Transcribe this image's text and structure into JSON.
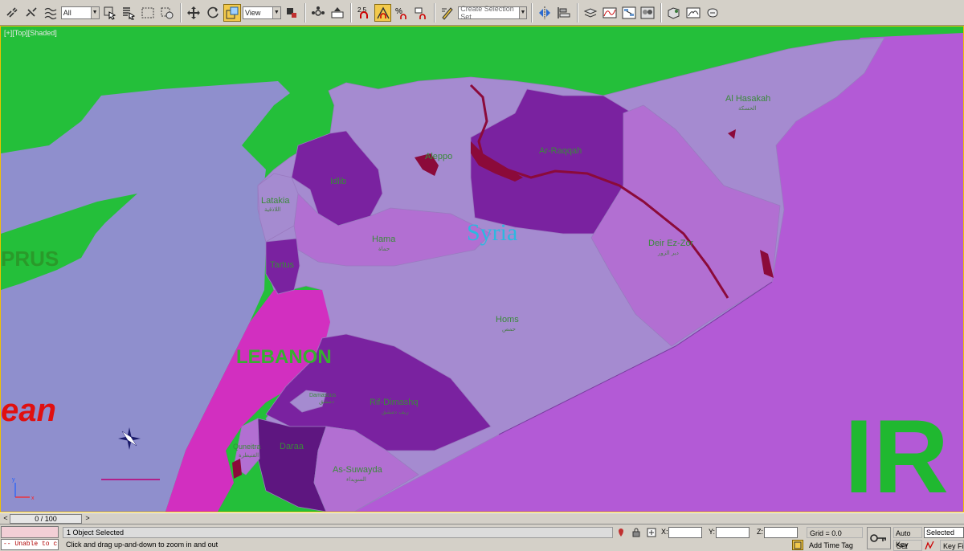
{
  "toolbar": {
    "selection_filter": "All",
    "reference_coord": "View",
    "snap_label": "2.5",
    "named_selection_placeholder": "Create Selection Set",
    "icons": [
      "link-icon",
      "unlink-icon",
      "bind-spacewarp-icon",
      "select-object-icon",
      "select-by-name-icon",
      "rect-region-icon",
      "window-crossing-icon",
      "move-icon",
      "rotate-icon",
      "scale-icon",
      "pivot-icon",
      "manipulate-icon",
      "keyboard-shortcut-icon",
      "snaps-toggle-icon",
      "angle-snap-icon",
      "percent-snap-icon",
      "spinner-snap-icon",
      "edit-named-selection-icon",
      "mirror-icon",
      "align-icon",
      "layer-manager-icon",
      "curve-editor-icon",
      "schematic-view-icon",
      "material-editor-icon",
      "render-setup-icon",
      "rendered-frame-icon",
      "render-production-icon"
    ]
  },
  "viewport": {
    "label": "[+][Top][Shaded]",
    "regions": [
      "Al Hasakah",
      "Ar-Raqqah",
      "Aleppo",
      "Idlib",
      "Latakia",
      "Hama",
      "Tartus",
      "Deir Ez-Zor",
      "Homs",
      "Rif-Dimashq",
      "Damascus",
      "Quneitra",
      "Daraa",
      "As-Suwayda"
    ],
    "labels": {
      "syria": "Syria",
      "lebanon": "LEBANON",
      "cyprus": "PRUS",
      "mediterranean": "ean",
      "iraq": "IR",
      "al_hasakah": "Al Hasakah",
      "al_hasakah_ar": "الحسكة",
      "ar_raqqah": "Ar-Raqqah",
      "aleppo": "Aleppo",
      "idlib": "Idlib",
      "latakia": "Latakia",
      "latakia_ar": "اللاذقية",
      "hama": "Hama",
      "hama_ar": "حماة",
      "tartus": "Tartus",
      "deir": "Deir Ez-Zor",
      "deir_ar": "دير الزور",
      "homs": "Homs",
      "homs_ar": "حمص",
      "rif": "Rif-Dimashq",
      "rif_ar": "ريف دمشق",
      "damascus": "Damascus",
      "damascus_ar": "دمشق",
      "quneitra": "Quneitra",
      "quneitra_ar": "القنيطرة",
      "daraa": "Daraa",
      "suwayda": "As-Suwayda",
      "suwayda_ar": "السويداء"
    },
    "colors": {
      "land_green": "#24bf3a",
      "sea": "#8f8fcd",
      "syria_light": "#a58bd0",
      "syria_mid": "#b26fd2",
      "syria_dark": "#7a22a0",
      "syria_darkest": "#5e1680",
      "lebanon": "#d22fc0",
      "iraq": "#b35ad6",
      "river": "#8b0a3a"
    }
  },
  "timeslider": {
    "position": "0 / 100",
    "left_arrow": "<",
    "right_arrow": ">"
  },
  "status": {
    "maxscript_output": "-- Unable to c",
    "selection_info": "1 Object Selected",
    "prompt": "Click and drag up-and-down to zoom in and out",
    "x_label": "X:",
    "y_label": "Y:",
    "z_label": "Z:",
    "grid": "Grid = 0.0",
    "time_tag": "Add Time Tag",
    "auto_key": "Auto Key",
    "set_key": "Set Key",
    "selected_option": "Selected",
    "key_filters": "Key Filters..."
  }
}
